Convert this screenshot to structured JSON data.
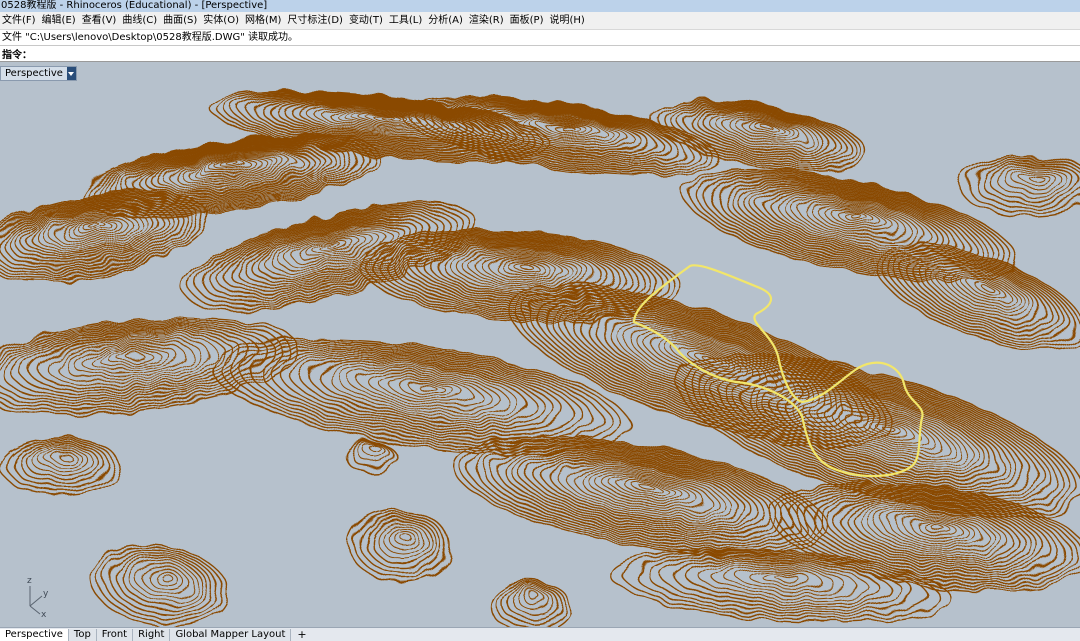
{
  "window": {
    "title": "0528教程版 - Rhinoceros (Educational) - [Perspective]"
  },
  "menu": [
    {
      "label": "文件(F)"
    },
    {
      "label": "编辑(E)"
    },
    {
      "label": "查看(V)"
    },
    {
      "label": "曲线(C)"
    },
    {
      "label": "曲面(S)"
    },
    {
      "label": "实体(O)"
    },
    {
      "label": "网格(M)"
    },
    {
      "label": "尺寸标注(D)"
    },
    {
      "label": "变动(T)"
    },
    {
      "label": "工具(L)"
    },
    {
      "label": "分析(A)"
    },
    {
      "label": "渲染(R)"
    },
    {
      "label": "面板(P)"
    },
    {
      "label": "说明(H)"
    }
  ],
  "command_history": "文件 \"C:\\Users\\lenovo\\Desktop\\0528教程版.DWG\" 读取成功。",
  "command_prompt": {
    "label": "指令：",
    "value": ""
  },
  "viewport": {
    "name": "Perspective",
    "background": "#b6c1cc",
    "contour_color": "#8a4a00",
    "selection_color": "#f2e66a",
    "axis_labels": {
      "x": "x",
      "y": "y",
      "z": "z"
    }
  },
  "tabs": [
    {
      "label": "Perspective",
      "active": true
    },
    {
      "label": "Top",
      "active": false
    },
    {
      "label": "Front",
      "active": false
    },
    {
      "label": "Right",
      "active": false
    },
    {
      "label": "Global Mapper Layout",
      "active": false
    }
  ],
  "tab_add_label": "+"
}
